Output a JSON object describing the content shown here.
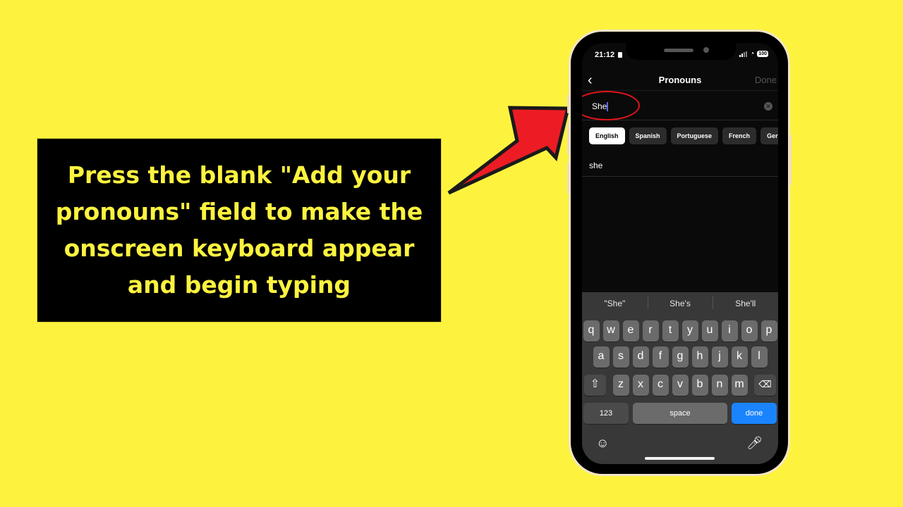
{
  "callout": {
    "text": "Press the blank \"Add your pronouns\" field to make the onscreen keyboard appear and begin typing"
  },
  "colors": {
    "background": "#fdf33f",
    "callout_bg": "#000000",
    "callout_text": "#fdf33f",
    "arrow": "#ed1c24",
    "highlight": "#e2141b",
    "done_key": "#1a84ff"
  },
  "status_bar": {
    "time": "21:12",
    "battery": "100",
    "icons": [
      "person-badge-icon",
      "signal-icon",
      "wifi-icon",
      "battery-icon"
    ]
  },
  "nav": {
    "back_icon": "chevron-left-icon",
    "title": "Pronouns",
    "done_label": "Done"
  },
  "input": {
    "value": "She",
    "clear_icon": "clear-circle-icon"
  },
  "language_chips": [
    {
      "label": "English",
      "selected": true
    },
    {
      "label": "Spanish",
      "selected": false
    },
    {
      "label": "Portuguese",
      "selected": false
    },
    {
      "label": "French",
      "selected": false
    },
    {
      "label": "German",
      "selected": false
    }
  ],
  "results": [
    {
      "label": "she"
    }
  ],
  "keyboard": {
    "suggestions": [
      "\"She\"",
      "She's",
      "She'll"
    ],
    "row1": [
      "q",
      "w",
      "e",
      "r",
      "t",
      "y",
      "u",
      "i",
      "o",
      "p"
    ],
    "row2": [
      "a",
      "s",
      "d",
      "f",
      "g",
      "h",
      "j",
      "k",
      "l"
    ],
    "row3": [
      "z",
      "x",
      "c",
      "v",
      "b",
      "n",
      "m"
    ],
    "shift_icon": "shift-icon",
    "backspace_icon": "backspace-icon",
    "numbers_label": "123",
    "space_label": "space",
    "done_label": "done",
    "emoji_icon": "emoji-icon",
    "mic_icon": "microphone-icon"
  }
}
